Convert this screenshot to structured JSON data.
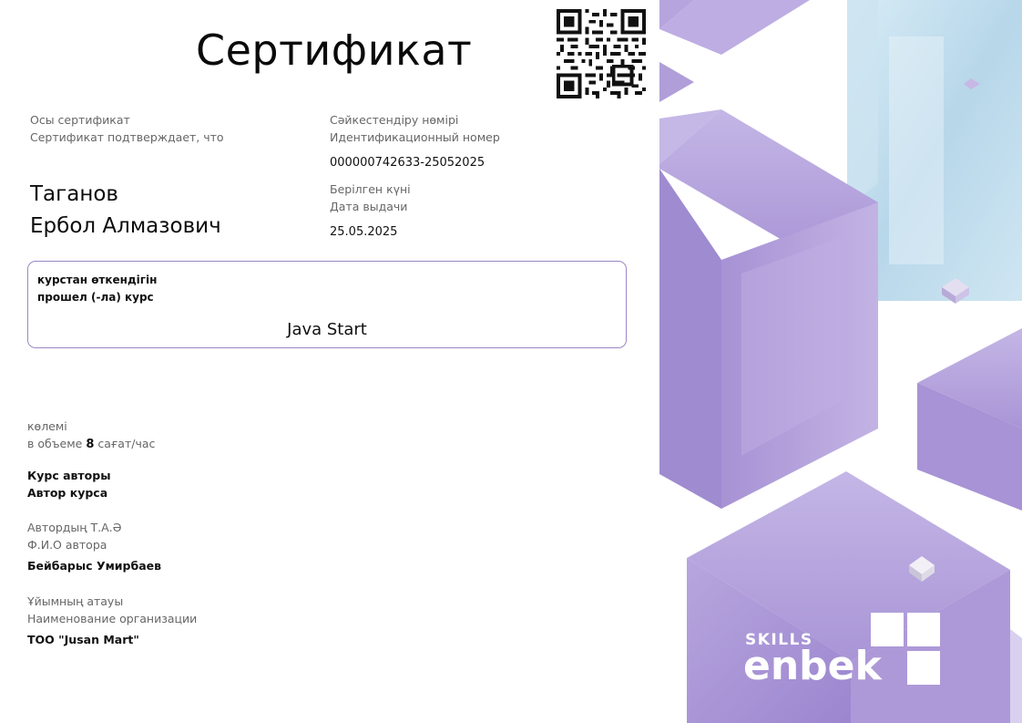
{
  "certificate": {
    "title": "Сертификат",
    "confirms_kk": "Осы сертификат",
    "confirms_ru": "Сертификат подтверждает, что",
    "id_label_kk": "Сәйкестендіру нөмірі",
    "id_label_ru": "Идентификационный номер",
    "id_value": "000000742633-25052025",
    "date_label_kk": "Берілген күні",
    "date_label_ru": "Дата выдачи",
    "date_value": "25.05.2025",
    "name_line1": "Таганов",
    "name_line2": "Ербол Алмазович",
    "course_label_kk": "курстан өткендігін",
    "course_label_ru": "прошел (-ла) курс",
    "course_name": "Java Start",
    "volume_label_kk": "көлемі",
    "volume_prefix": "в объеме",
    "volume_value": "8",
    "volume_suffix": "сағат/час",
    "author_label_kk": "Курс авторы",
    "author_label_ru": "Автор курса",
    "author_fio_kk": "Автордың Т.А.Ә",
    "author_fio_ru": "Ф.И.О автора",
    "author_name": "Бейбарыс Умирбаев",
    "org_label_kk": "Ұйымның атауы",
    "org_label_ru": "Наименование организации",
    "org_name": "ТОО \"Jusan Mart\""
  },
  "logo": {
    "small": "SKILLS",
    "big": "enbek"
  },
  "colors": {
    "accent_border": "#9a86c8",
    "cube_purple": "#a38fd0",
    "cube_blue": "#bcd8ea",
    "label_gray": "#666666"
  },
  "icons": [
    "qr-code-icon",
    "enbek-logo-squares-icon"
  ]
}
